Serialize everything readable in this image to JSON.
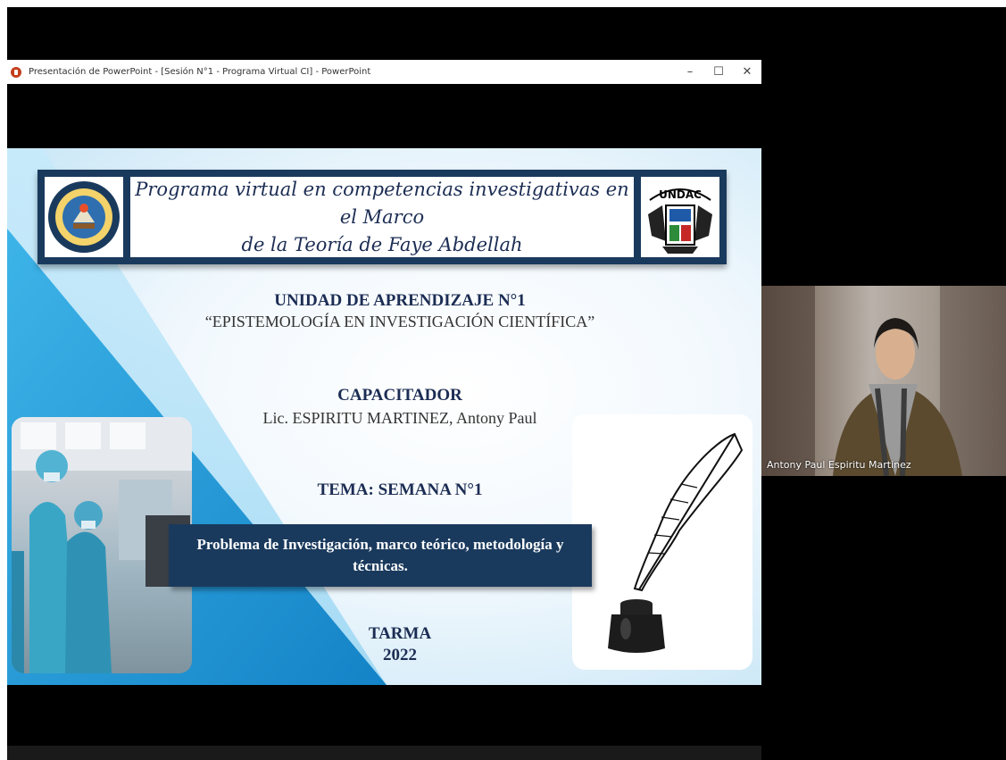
{
  "window": {
    "title": "Presentación de PowerPoint - [Sesión N°1 - Programa Virtual CI] - PowerPoint",
    "minimize": "–",
    "maximize": "☐",
    "close": "✕"
  },
  "slide": {
    "banner_title_line1": "Programa virtual en competencias investigativas en el Marco",
    "banner_title_line2": "de la Teoría de Faye Abdellah",
    "logo_right_text": "UNDAC",
    "unit_title": "UNIDAD DE APRENDIZAJE N°1",
    "unit_subtitle": "“EPISTEMOLOGÍA EN INVESTIGACIÓN CIENTÍFICA”",
    "trainer_heading": "CAPACITADOR",
    "trainer_name": "Lic. ESPIRITU MARTINEZ, Antony Paul",
    "topic": "TEMA: SEMANA N°1",
    "problem_text": "Problema de Investigación, marco teórico, metodología y técnicas.",
    "city": "TARMA",
    "year": "2022"
  },
  "participant": {
    "name": "Antony Paul Espiritu Martinez"
  },
  "colors": {
    "navy": "#1a3a5d",
    "accent_blue": "#1e9bd7",
    "ppt_red": "#c43e1c"
  }
}
